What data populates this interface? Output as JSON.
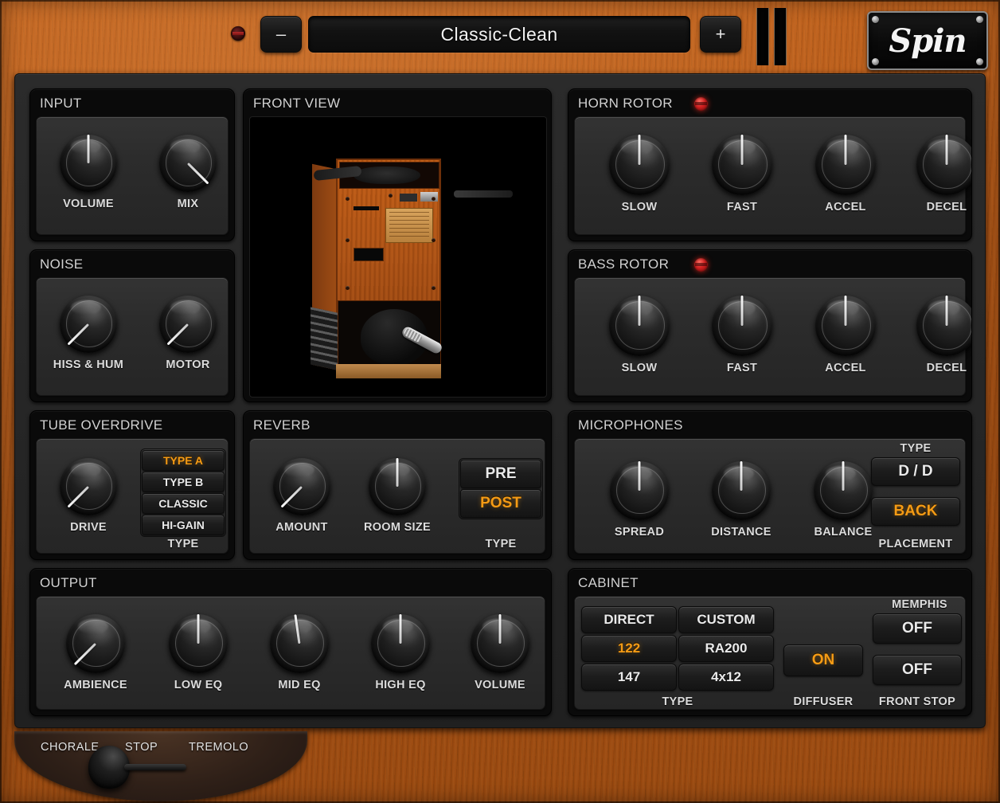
{
  "header": {
    "led_name": "power-led",
    "prev_label": "–",
    "next_label": "+",
    "preset_name": "Classic-Clean",
    "logo_text": "Spin"
  },
  "input_panel": {
    "title": "INPUT",
    "knobs": [
      {
        "label": "VOLUME",
        "angle": 0
      },
      {
        "label": "MIX",
        "angle": 135
      }
    ]
  },
  "noise_panel": {
    "title": "NOISE",
    "knobs": [
      {
        "label": "HISS & HUM",
        "angle": -135
      },
      {
        "label": "MOTOR",
        "angle": -135
      }
    ]
  },
  "front_view_panel": {
    "title": "FRONT VIEW"
  },
  "tube_overdrive_panel": {
    "title": "TUBE OVERDRIVE",
    "knob": {
      "label": "DRIVE",
      "angle": -135
    },
    "type_label": "TYPE",
    "types": [
      {
        "label": "TYPE A",
        "active": true
      },
      {
        "label": "TYPE B",
        "active": false
      },
      {
        "label": "CLASSIC",
        "active": false
      },
      {
        "label": "HI-GAIN",
        "active": false
      }
    ]
  },
  "reverb_panel": {
    "title": "REVERB",
    "knobs": [
      {
        "label": "AMOUNT",
        "angle": -135
      },
      {
        "label": "ROOM SIZE",
        "angle": 0
      }
    ],
    "type_label": "TYPE",
    "types": [
      {
        "label": "PRE",
        "active": false
      },
      {
        "label": "POST",
        "active": true
      }
    ]
  },
  "output_panel": {
    "title": "OUTPUT",
    "knobs": [
      {
        "label": "AMBIENCE",
        "angle": -135
      },
      {
        "label": "LOW EQ",
        "angle": 0
      },
      {
        "label": "MID EQ",
        "angle": -8
      },
      {
        "label": "HIGH EQ",
        "angle": 0
      },
      {
        "label": "VOLUME",
        "angle": 0
      }
    ]
  },
  "horn_rotor_panel": {
    "title": "HORN ROTOR",
    "led_on": true,
    "knobs": [
      {
        "label": "SLOW",
        "angle": 0
      },
      {
        "label": "FAST",
        "angle": 0
      },
      {
        "label": "ACCEL",
        "angle": 0
      },
      {
        "label": "DECEL",
        "angle": 0
      }
    ]
  },
  "bass_rotor_panel": {
    "title": "BASS ROTOR",
    "led_on": true,
    "knobs": [
      {
        "label": "SLOW",
        "angle": 0
      },
      {
        "label": "FAST",
        "angle": 0
      },
      {
        "label": "ACCEL",
        "angle": 0
      },
      {
        "label": "DECEL",
        "angle": 0
      }
    ]
  },
  "microphones_panel": {
    "title": "MICROPHONES",
    "knobs": [
      {
        "label": "SPREAD",
        "angle": 0
      },
      {
        "label": "DISTANCE",
        "angle": 0
      },
      {
        "label": "BALANCE",
        "angle": 0
      }
    ],
    "type_label": "TYPE",
    "type_value": "D / D",
    "placement_label": "PLACEMENT",
    "placement_value": "BACK"
  },
  "cabinet_panel": {
    "title": "CABINET",
    "type_label": "TYPE",
    "types": [
      {
        "label": "DIRECT",
        "active": false
      },
      {
        "label": "CUSTOM",
        "active": false
      },
      {
        "label": "122",
        "active": true
      },
      {
        "label": "RA200",
        "active": false
      },
      {
        "label": "147",
        "active": false
      },
      {
        "label": "4x12",
        "active": false
      }
    ],
    "diffuser_label": "DIFFUSER",
    "diffuser_value": "ON",
    "memphis_label": "MEMPHIS",
    "memphis_value": "OFF",
    "front_stop_label": "FRONT STOP",
    "front_stop_value": "OFF"
  },
  "speed_switch": {
    "labels": [
      "CHORALE",
      "STOP",
      "TREMOLO"
    ],
    "position": "STOP"
  },
  "colors": {
    "accent": "#f59b15",
    "wood": "#b85a17",
    "panel_bg": "#0a0a0a",
    "body_bg": "#2c2c2c",
    "text": "#dcdcdc",
    "led_red": "#d42020"
  }
}
